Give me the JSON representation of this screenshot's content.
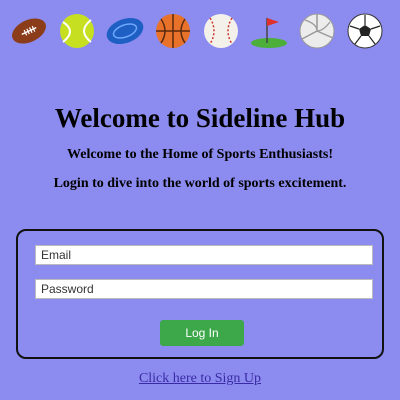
{
  "header": {
    "icons": [
      "american-football-icon",
      "tennis-ball-icon",
      "frisbee-icon",
      "basketball-icon",
      "baseball-icon",
      "golf-icon",
      "volleyball-icon",
      "soccer-ball-icon"
    ]
  },
  "main": {
    "title": "Welcome to Sideline Hub",
    "subtitle": "Welcome to the Home of Sports Enthusiasts!",
    "tagline": "Login to dive into the world of sports excitement."
  },
  "login": {
    "email_placeholder": "Email",
    "password_placeholder": "Password",
    "button_label": "Log In"
  },
  "signup": {
    "link_text": "Click here to Sign Up"
  },
  "colors": {
    "background": "#8c8cf0",
    "button": "#3da84a",
    "link": "#3a2aa6"
  }
}
